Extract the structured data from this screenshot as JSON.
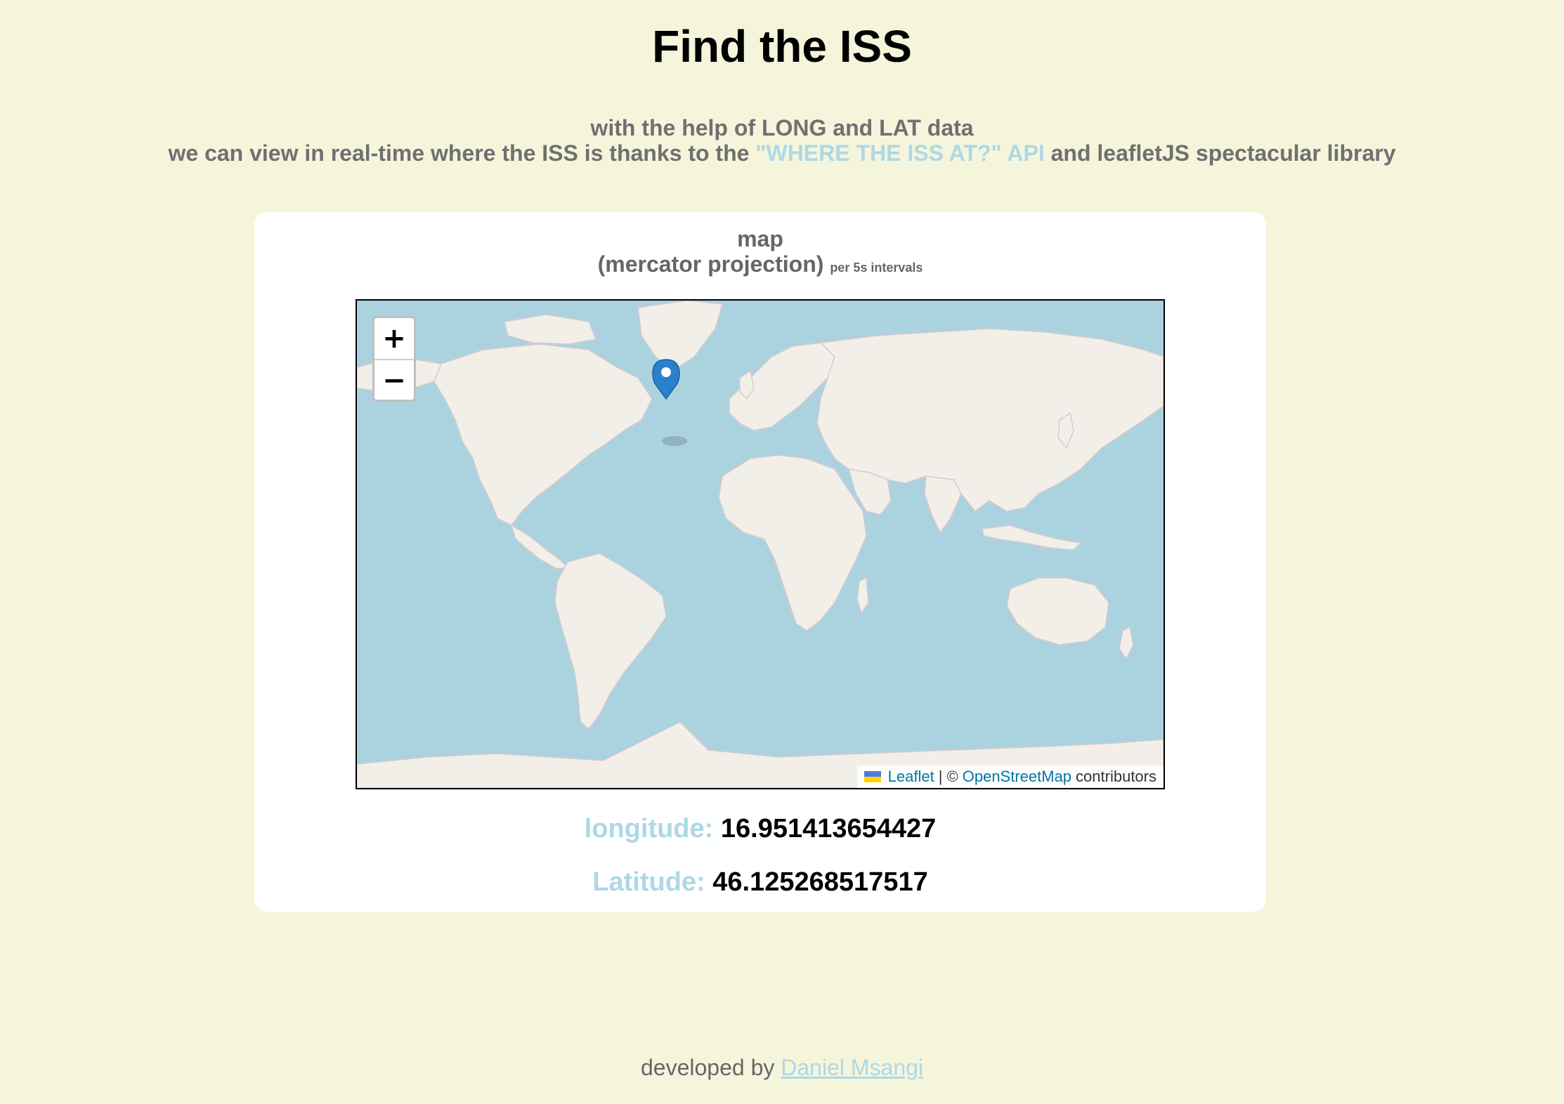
{
  "header": {
    "title": "Find the ISS",
    "line1": "with the help of LONG and LAT data",
    "line2_before": "we can view in real-time where the ISS is thanks to the ",
    "api_link": "\"WHERE THE ISS AT?\" API",
    "line2_after": " and leafletJS spectacular library"
  },
  "card": {
    "heading": "map",
    "subheading": "(mercator projection)",
    "interval_note": "per 5s intervals"
  },
  "map": {
    "zoom_in_label": "+",
    "zoom_out_label": "−",
    "attribution_leaflet": "Leaflet",
    "attribution_sep": "| ©",
    "attribution_osm": "OpenStreetMap",
    "attribution_contributors": "contributors",
    "water_color": "#aad3df",
    "land_color": "#f2efe9",
    "marker_color": "#2a81cb",
    "marker_icon": "map-marker-icon"
  },
  "coordinates": {
    "longitude_label": "longitude:",
    "longitude_value": "16.951413654427",
    "latitude_label": "Latitude:",
    "latitude_value": "46.125268517517"
  },
  "footer": {
    "prefix": "developed by",
    "author": "Daniel Msangi"
  },
  "colors": {
    "background": "#f5f5dc",
    "accent": "#add8e6",
    "muted_text": "#707070"
  }
}
